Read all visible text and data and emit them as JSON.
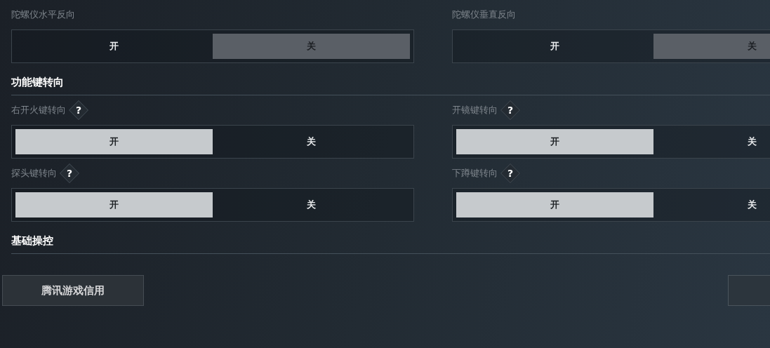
{
  "sections": [
    {
      "settings": [
        {
          "label": "陀螺仪水平反向",
          "kind": "dim",
          "options": [
            {
              "label": "开",
              "selected": false
            },
            {
              "label": "关",
              "selected": true
            }
          ]
        },
        {
          "label": "陀螺仪垂直反向",
          "kind": "dim",
          "options": [
            {
              "label": "开",
              "selected": false
            },
            {
              "label": "关",
              "selected": true
            }
          ]
        }
      ]
    },
    {
      "title": "功能键转向",
      "settings": [
        {
          "label": "右开火键转向",
          "kind": "bright",
          "help": "?",
          "options": [
            {
              "label": "开",
              "selected": true
            },
            {
              "label": "关",
              "selected": false
            }
          ]
        },
        {
          "label": "开镜键转向",
          "kind": "bright",
          "help": "?",
          "options": [
            {
              "label": "开",
              "selected": true
            },
            {
              "label": "关",
              "selected": false
            }
          ]
        },
        {
          "label": "探头键转向",
          "kind": "bright",
          "help": "?",
          "options": [
            {
              "label": "开",
              "selected": true
            },
            {
              "label": "关",
              "selected": false
            }
          ]
        },
        {
          "label": "下蹲键转向",
          "kind": "bright",
          "help": "?",
          "options": [
            {
              "label": "开",
              "selected": true
            },
            {
              "label": "关",
              "selected": false
            }
          ]
        }
      ]
    },
    {
      "title": "基础操控"
    }
  ],
  "footer_button": "腾讯游戏信用"
}
